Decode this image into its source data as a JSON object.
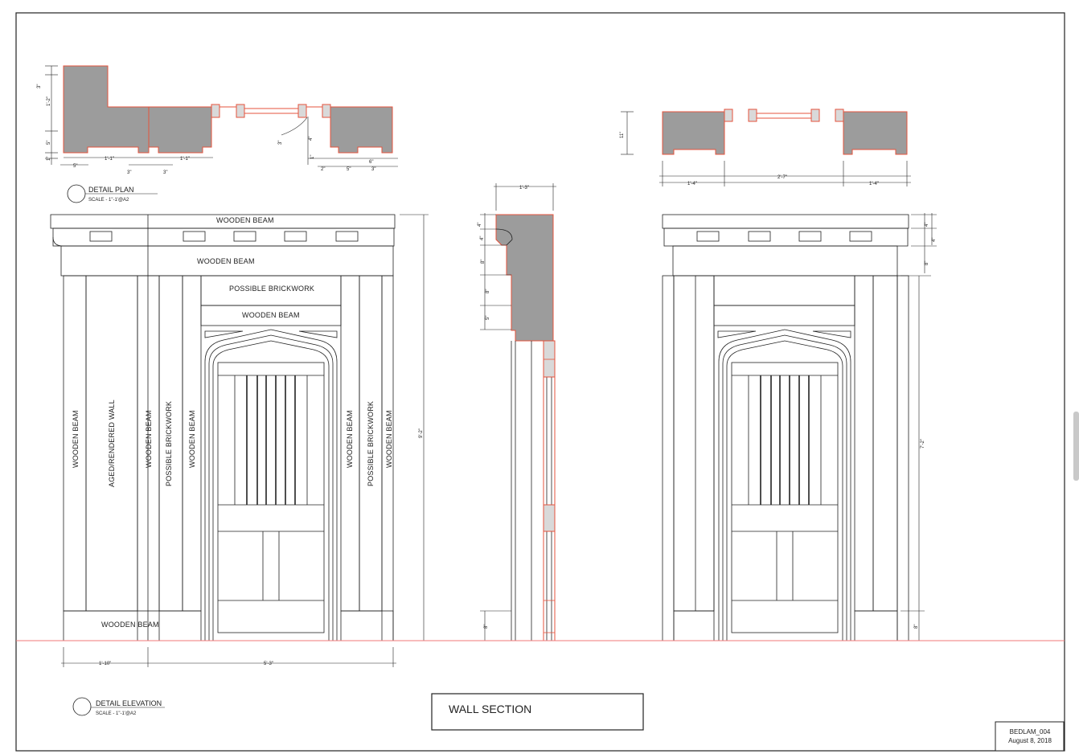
{
  "sheet": {
    "section_title": "WALL SECTION",
    "drawing_number": "BEDLAM_004",
    "date": "August 8, 2018"
  },
  "plan_title": {
    "name": "DETAIL PLAN",
    "scale": "SCALE - 1\"-1'@A2"
  },
  "elevation_title": {
    "name": "DETAIL ELEVATION",
    "scale": "SCALE - 1\"-1'@A2"
  },
  "elevation_labels": {
    "wooden_beam_top": "WOODEN BEAM",
    "wooden_beam_lintel": "WOODEN BEAM",
    "possible_brickwork_top": "POSSIBLE BRICKWORK",
    "wooden_beam_door_head": "WOODEN BEAM",
    "wooden_beam_base": "WOODEN BEAM",
    "wooden_beam_v1": "WOODEN BEAM",
    "aged_rendered_wall": "AGED/RENDERED WALL",
    "wooden_beam_v2": "WOODEN BEAM",
    "possible_brickwork_v1": "POSSIBLE BRICKWORK",
    "wooden_beam_v3": "WOODEN BEAM",
    "wooden_beam_v4": "WOODEN BEAM",
    "possible_brickwork_v2": "POSSIBLE BRICKWORK",
    "wooden_beam_v5": "WOODEN BEAM"
  },
  "dimensions": {
    "plan_left": {
      "d3": "3\"",
      "d1_2": "1'-2\"",
      "d5": "5\"",
      "d1": "1\"",
      "d5b": "5\"",
      "d1_1a": "1'-1\"",
      "d3a": "3\"",
      "d3b": "3\"",
      "d1_1b": "1'-1\"",
      "d3c": "3\"",
      "d4": "4\"",
      "d1b": "1\"",
      "d2": "2\"",
      "d5c": "5\"",
      "d6": "6\"",
      "d3d": "3\""
    },
    "plan_right": {
      "d11": "11\"",
      "d1_4a": "1'-4\"",
      "d2_7": "2'-7\"",
      "d1_4b": "1'-4\""
    },
    "elevation_left": {
      "d1_10": "1'-10\"",
      "d5_3": "5'-3\"",
      "d9_2": "9'-2\""
    },
    "section": {
      "d1_3": "1'-3\"",
      "d4a": "4\"",
      "d4b": "4\"",
      "d8a": "8\"",
      "d8b": "8\"",
      "d5": "5\"",
      "d8c": "8\""
    },
    "elevation_right": {
      "d4a": "4\"",
      "d4b": "4\"",
      "d8a": "8\"",
      "d7_2": "7'-2\"",
      "d8b": "8\""
    }
  },
  "colors": {
    "line": "#222222",
    "section_red": "#e5533d",
    "poche": "#9c9c9c",
    "ground": "#f07a7a",
    "sheet_bg": "#ffffff"
  }
}
